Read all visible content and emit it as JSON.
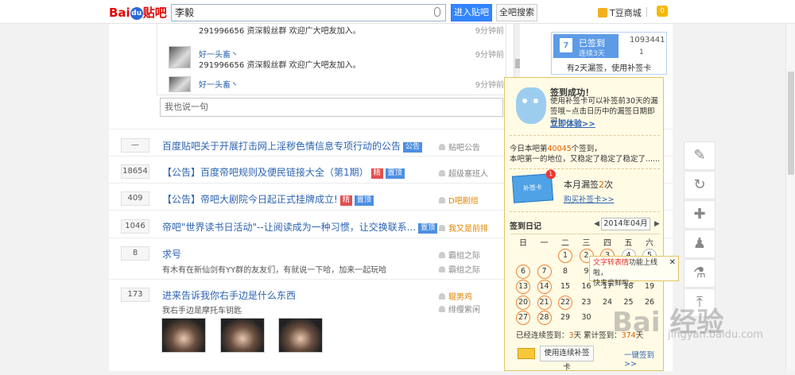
{
  "header": {
    "logo_bai": "Bai",
    "logo_du": "du",
    "logo_tieba": "贴吧",
    "search_value": "李毅",
    "enter_label": "进入贴吧",
    "all_search_label": "全吧搜索",
    "tdou_label": "T豆商城",
    "msg_badge": "0"
  },
  "replies": [
    {
      "name": "",
      "text": "291996656 资深毅丝群 欢迎广大吧友加入。",
      "time": "9分钟前"
    },
    {
      "name": "好一头畜丶",
      "text": "291996656 资深毅丝群 欢迎广大吧友加入。",
      "time": "9分钟前"
    },
    {
      "name": "好一头畜丶",
      "text": "",
      "time": "9分钟前"
    }
  ],
  "say_placeholder": "我也说一句",
  "threads": [
    {
      "count": "—",
      "title": "百度贴吧关于开展打击网上淫秽色情信息专项行动的公告",
      "tag1": "公告",
      "author": "贴吧公告",
      "sub": ""
    },
    {
      "count": "18654",
      "title": "【公告】百度帝吧规则及便民链接大全（第1期）",
      "tag1": "精",
      "tag2": "置顶",
      "author": "超级塞班人",
      "sub": ""
    },
    {
      "count": "409",
      "title": "【公告】帝吧大剧院今日起正式挂牌成立!",
      "tag1": "精",
      "tag2": "置顶",
      "author": "D吧剧组",
      "sub": ""
    },
    {
      "count": "1046",
      "title": "帝吧\"世界读书日活动\"--让阅读成为一种习惯，让交换联系...",
      "tag1": "置顶",
      "author": "我又是前排",
      "sub": ""
    },
    {
      "count": "8",
      "title": "求号",
      "sub": "有木有在新仙剑有YY群的友友们，有就说一下哈，加来一起玩哈",
      "author": "霸组之际",
      "author2": "霸组之际"
    },
    {
      "count": "173",
      "title": "进来告诉我你右手边是什么东西",
      "sub": "我右手边是摩托车钥匙",
      "author": "辊男鸡",
      "author2": "绯缨紫闲"
    }
  ],
  "sign": {
    "signed_label": "已签到",
    "streak_label": "连续3天",
    "rank_value": "1093441",
    "rank_small": "1",
    "cal_day": "7",
    "buqian_text": "有2天漏签，使用补签卡"
  },
  "popup": {
    "success": "签到成功！",
    "desc": "使用补签卡可以补签前30天的漏签哦~点击日历中的漏签日期即可!",
    "try_link": "立即体验>>",
    "rank_prefix": "今日本吧第",
    "rank_num": "40045",
    "rank_suffix": "个签到，",
    "rank_line2": "本吧第一的地位，又稳定了稳定了稳定了......",
    "card_label": "补签卡",
    "card_badge": "1",
    "missed_prefix": "本月漏签",
    "missed_num": "2",
    "missed_suffix": "次",
    "buy_link": "购买补签卡>>",
    "rili_label": "签到日记",
    "month": "2014年04月",
    "weekdays": [
      "日",
      "一",
      "二",
      "三",
      "四",
      "五",
      "六"
    ],
    "tip_prefix": "文字转表情",
    "tip_mid": "功能上线啦，",
    "tip_line2": "快来尝鲜啦~",
    "stats_prefix": "已经连续签到：",
    "stats_cont": "3",
    "stats_mid": "天  累计签到：",
    "stats_total": "374",
    "stats_suffix": "天",
    "use_card_label": "使用连续补签卡",
    "one_click": "一键签到>>"
  },
  "calendar": {
    "weeks": [
      [
        "",
        "",
        "1",
        "2",
        "3",
        "4",
        "5"
      ],
      [
        "6",
        "7",
        "8",
        "9",
        "10",
        "11",
        "12"
      ],
      [
        "13",
        "14",
        "15",
        "16",
        "17",
        "18",
        "19"
      ],
      [
        "20",
        "21",
        "22",
        "23",
        "24",
        "25",
        "26"
      ],
      [
        "27",
        "28",
        "29",
        "30",
        "",
        "",
        ""
      ]
    ],
    "signed": [
      "1",
      "2",
      "3",
      "6",
      "7",
      "13",
      "14",
      "20",
      "21",
      "22",
      "27",
      "28"
    ]
  },
  "watermark": {
    "text": "Bai 经验",
    "sub": "jingyan.baidu.com"
  },
  "toolbar_icons": [
    "edit-icon",
    "refresh-icon",
    "plus-icon",
    "user-icon",
    "flask-icon",
    "top-icon"
  ]
}
